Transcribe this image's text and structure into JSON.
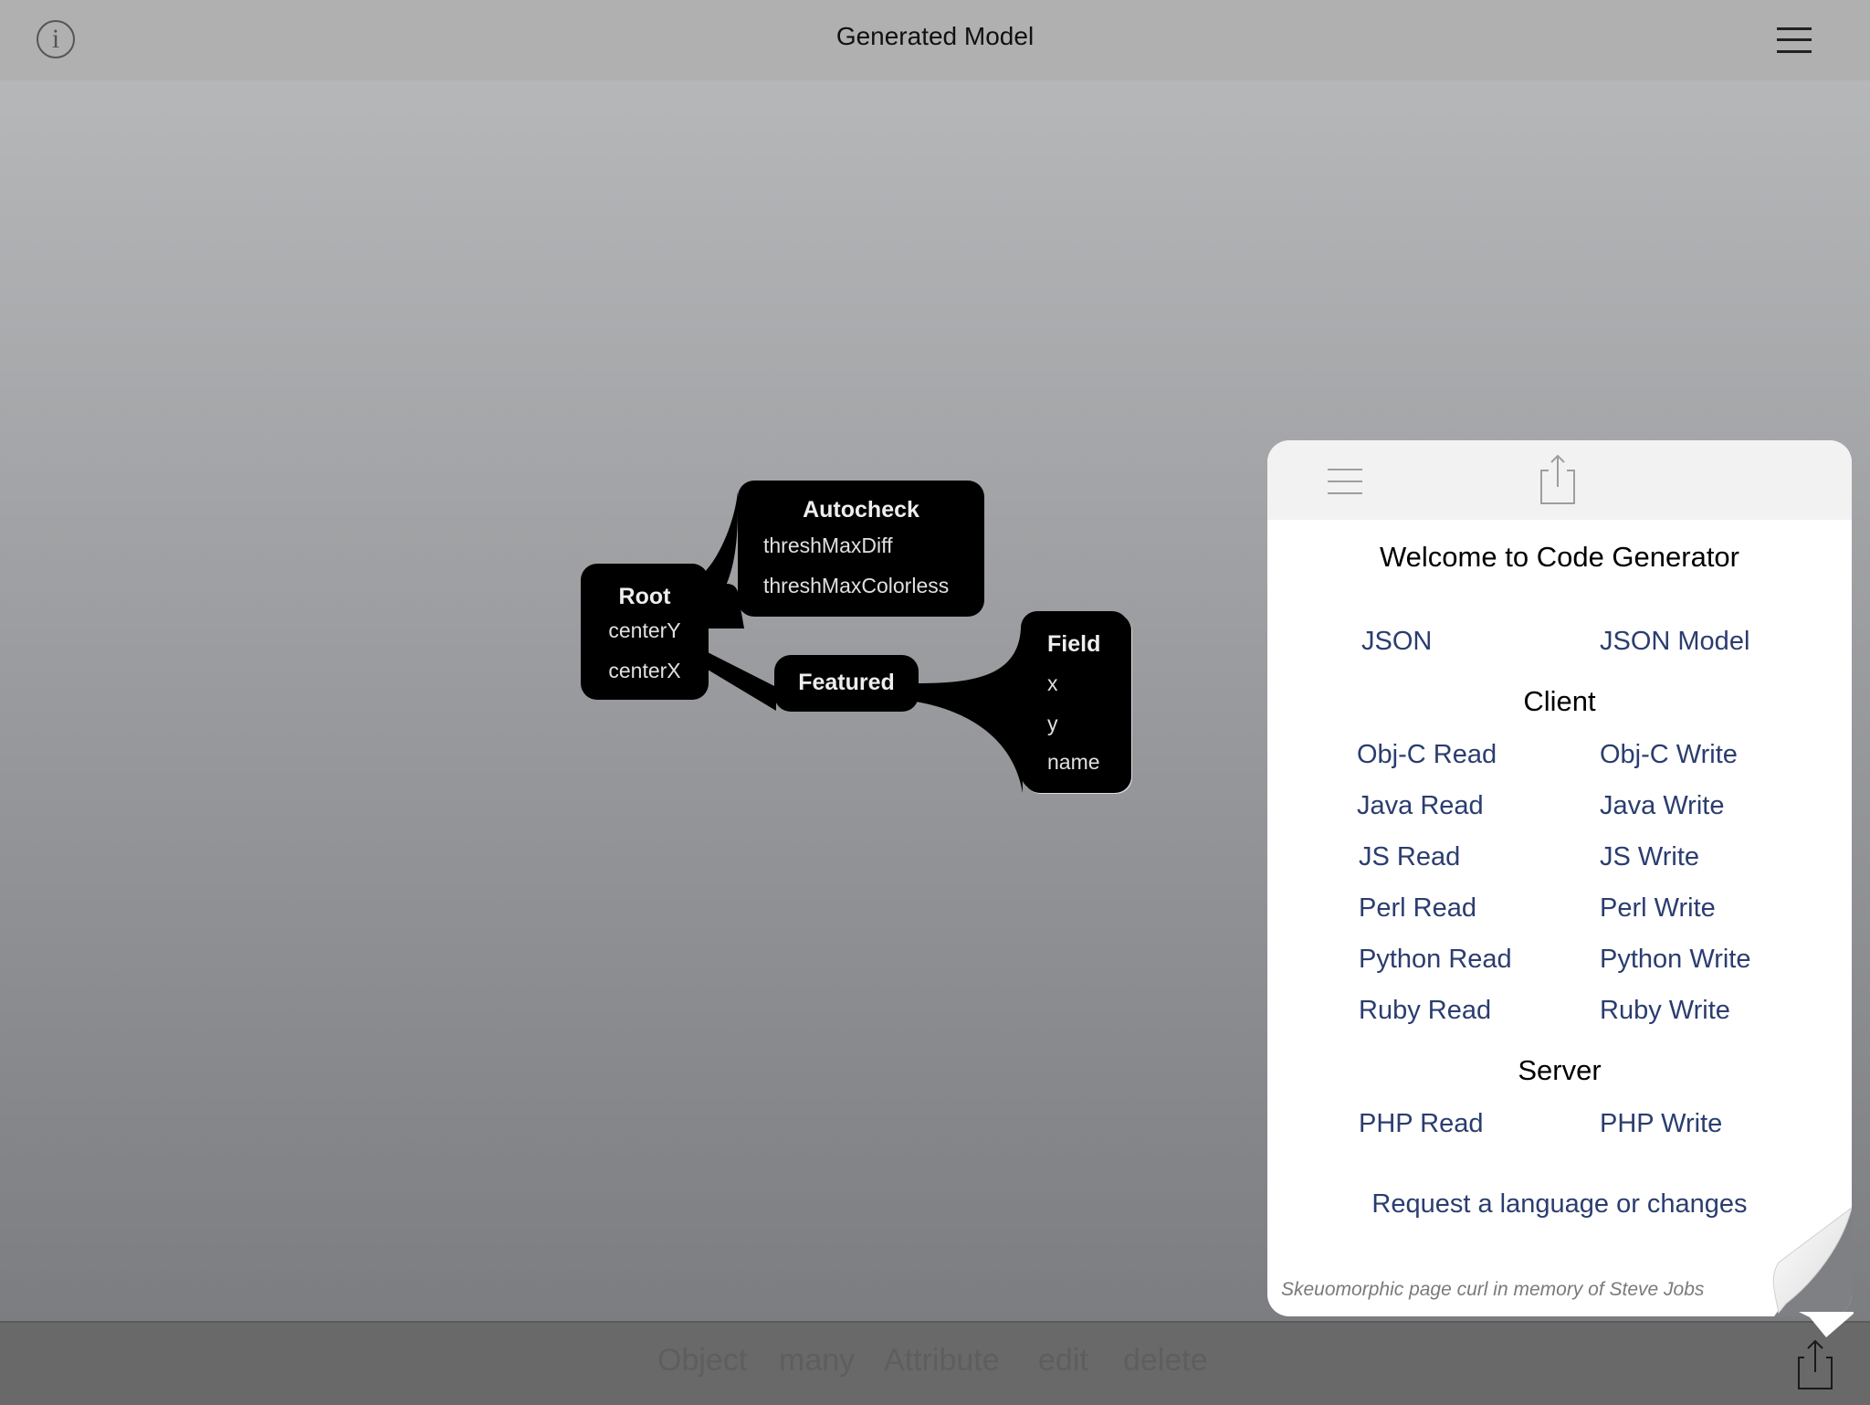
{
  "topbar": {
    "title": "Generated Model",
    "info_icon_glyph": "i",
    "info_icon": "info-icon",
    "menu_icon": "hamburger-menu-icon"
  },
  "diagram": {
    "nodes": [
      {
        "id": "root",
        "name": "Root",
        "attributes": [
          "centerY",
          "centerX"
        ]
      },
      {
        "id": "autocheck",
        "name": "Autocheck",
        "attributes": [
          "threshMaxDiff",
          "threshMaxColorless"
        ]
      },
      {
        "id": "featured",
        "name": "Featured",
        "attributes": []
      },
      {
        "id": "field",
        "name": "Field",
        "attributes": [
          "x",
          "y",
          "name"
        ]
      }
    ],
    "links": [
      {
        "from": "root",
        "to": "autocheck",
        "type": "one"
      },
      {
        "from": "root",
        "to": "featured",
        "type": "one"
      },
      {
        "from": "featured",
        "to": "field",
        "type": "many"
      }
    ]
  },
  "bottombar": {
    "items": [
      "Object",
      "many",
      "Attribute",
      "edit",
      "delete"
    ],
    "share_icon": "share-icon"
  },
  "panel": {
    "title": "Welcome to Code Generator",
    "top_links": [
      "JSON",
      "JSON Model"
    ],
    "client_heading": "Client",
    "client_links": [
      [
        "Obj-C Read",
        "Obj-C Write"
      ],
      [
        "Java Read",
        "Java Write"
      ],
      [
        "JS Read",
        "JS Write"
      ],
      [
        "Perl Read",
        "Perl Write"
      ],
      [
        "Python Read",
        "Python Write"
      ],
      [
        "Ruby Read",
        "Ruby Write"
      ]
    ],
    "server_heading": "Server",
    "server_links": [
      "PHP Read",
      "PHP Write"
    ],
    "request_link": "Request a language or changes",
    "footer_note": "Skeuomorphic page curl in memory of Steve Jobs"
  },
  "colors": {
    "link": "#2b3d6f",
    "topbar": "#b0b0b0",
    "bottombar": "#696969",
    "node_fill": "#000000"
  }
}
